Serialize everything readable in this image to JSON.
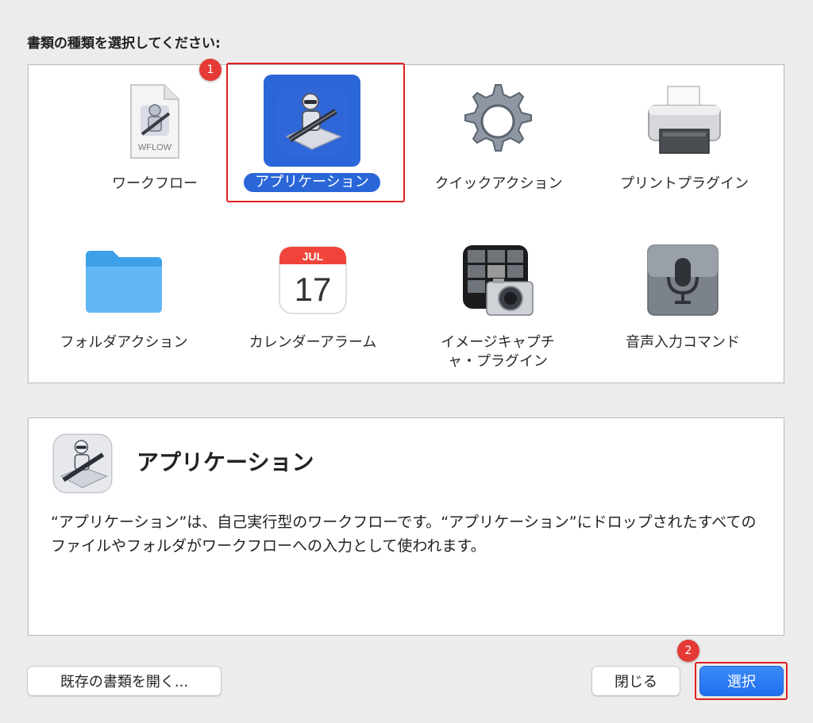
{
  "dialog": {
    "prompt": "書類の種類を選択してください:",
    "types": [
      {
        "label": "ワークフロー",
        "icon": "workflow-document-icon",
        "file_ext": "WFLOW"
      },
      {
        "label": "アプリケーション",
        "icon": "automator-robot-icon",
        "selected": true
      },
      {
        "label": "クイックアクション",
        "icon": "gear-icon"
      },
      {
        "label": "プリントプラグイン",
        "icon": "printer-icon"
      },
      {
        "label": "フォルダアクション",
        "icon": "folder-icon"
      },
      {
        "label": "カレンダーアラーム",
        "icon": "calendar-icon",
        "month": "JUL",
        "day": "17"
      },
      {
        "label": "イメージキャプチャ・プラグイン",
        "icon": "camera-icon"
      },
      {
        "label": "音声入力コマンド",
        "icon": "microphone-icon"
      }
    ],
    "description": {
      "title": "アプリケーション",
      "text": "“アプリケーション”は、自己実行型のワークフローです。“アプリケーション”にドロップされたすべてのファイルやフォルダがワークフローへの入力として使われます。"
    },
    "buttons": {
      "open_existing": "既存の書類を開く...",
      "close": "閉じる",
      "choose": "選択"
    },
    "markers": [
      "1",
      "2"
    ]
  },
  "colors": {
    "selection": "#2a66d8",
    "primary_button": "#1f6ef0",
    "highlight": "#e02020",
    "marker": "#e53935"
  }
}
